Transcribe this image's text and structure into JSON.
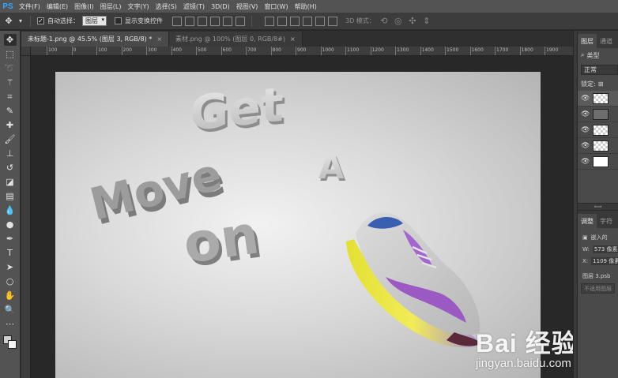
{
  "app": {
    "logo": "PS"
  },
  "menu": [
    "文件(F)",
    "编辑(E)",
    "图像(I)",
    "图层(L)",
    "文字(Y)",
    "选择(S)",
    "滤镜(T)",
    "3D(D)",
    "视图(V)",
    "窗口(W)",
    "帮助(H)"
  ],
  "options": {
    "auto_select_label": "自动选择：",
    "auto_select_value": "图层",
    "transform_controls_label": "显示变换控件",
    "mode_3d_label": "3D 模式："
  },
  "tabs": [
    {
      "title": "未标题-1.png @ 45.5% (图层 3, RGB/8) *",
      "close": "×"
    },
    {
      "title": "素材.png @ 100% (图层 0, RGB/8#)",
      "close": "×"
    }
  ],
  "ruler": {
    "h_labels": [
      "100",
      "0",
      "100",
      "200",
      "300",
      "400",
      "500",
      "600",
      "700",
      "800",
      "900",
      "1000",
      "1100",
      "1200",
      "1300",
      "1400",
      "1500",
      "1600",
      "1700",
      "1800",
      "1900"
    ]
  },
  "canvas": {
    "words": {
      "get": "Get",
      "a": "A",
      "move": "Move",
      "on": "on"
    }
  },
  "watermark": {
    "main": "Bai 经验",
    "sub": "jingyan.baidu.com"
  },
  "panels": {
    "tabs": [
      "图层",
      "通道"
    ],
    "filter_label": "类型",
    "blend_mode": "正常",
    "lock_label": "锁定:",
    "props_tabs": [
      "调整",
      "字符"
    ],
    "embedded_label": "嵌入的",
    "w_label": "W:",
    "w_value": "573 像素",
    "x_label": "X:",
    "x_value": "1109 像素",
    "layer_name": "图层 3.psb",
    "no_comp": "不适用图层"
  },
  "colors": {
    "accent": "#31a8ff",
    "shoe_purple": "#9b59c4",
    "shoe_yellow": "#e3e033"
  }
}
